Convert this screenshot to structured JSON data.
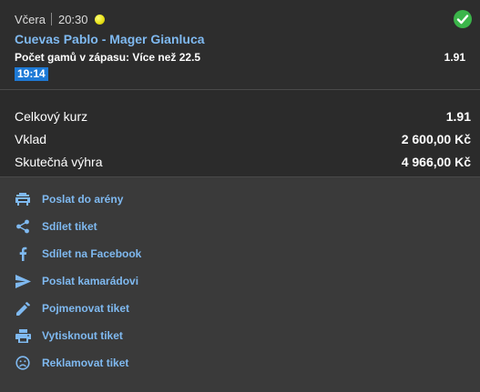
{
  "bet": {
    "day": "Včera",
    "time": "20:30",
    "sport_icon": "tennis-ball-icon",
    "status_icon": "check-circle-icon",
    "match": "Cuevas Pablo - Mager Gianluca",
    "market_label": "Počet gamů v zápasu: ",
    "market_pick": "Více než 22.5",
    "odds": "1.91",
    "live_time": "19:14"
  },
  "summary": {
    "total_odds_label": "Celkový kurz",
    "total_odds_value": "1.91",
    "stake_label": "Vklad",
    "stake_value": "2 600,00 Kč",
    "win_label": "Skutečná výhra",
    "win_value": "4 966,00 Kč"
  },
  "actions": [
    {
      "label": "Poslat do arény",
      "icon": "arena-icon"
    },
    {
      "label": "Sdílet tiket",
      "icon": "share-icon"
    },
    {
      "label": "Sdílet na Facebook",
      "icon": "facebook-icon"
    },
    {
      "label": "Poslat kamarádovi",
      "icon": "send-icon"
    },
    {
      "label": "Pojmenovat tiket",
      "icon": "pencil-icon"
    },
    {
      "label": "Vytisknout tiket",
      "icon": "printer-icon"
    },
    {
      "label": "Reklamovat tiket",
      "icon": "sad-face-icon"
    }
  ],
  "colors": {
    "link": "#7fb9f0",
    "success": "#3bb54a",
    "badge": "#1e7ad6"
  }
}
